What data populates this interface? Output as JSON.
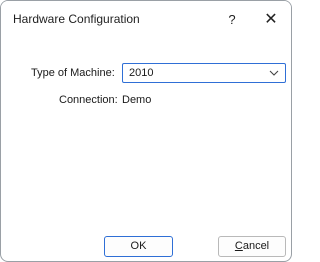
{
  "window": {
    "title": "Hardware Configuration",
    "help_glyph": "?",
    "close_glyph": "✕"
  },
  "form": {
    "type_label": "Type of Machine:",
    "type_value": "2010",
    "connection_label": "Connection:",
    "connection_value": "Demo"
  },
  "buttons": {
    "ok": "OK",
    "cancel_first": "C",
    "cancel_rest": "ancel"
  },
  "icons": {
    "dropdown": "chevron-down-icon",
    "help": "question-icon",
    "close": "close-icon"
  },
  "colors": {
    "focus_border": "#2f6fd6"
  }
}
